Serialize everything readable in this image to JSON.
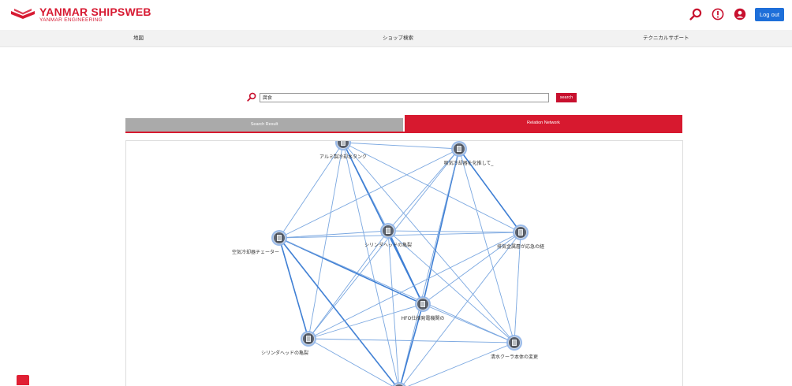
{
  "header": {
    "brand_name": "YANMAR SHIPSWEB",
    "brand_sub": "YANMAR ENGINEERING",
    "logout_label": "Log out",
    "icons": [
      "search-icon",
      "info-icon",
      "user-icon"
    ],
    "accent_color": "#d71a32",
    "logout_color": "#1e6fd9"
  },
  "nav": {
    "items": [
      {
        "label": "地図"
      },
      {
        "label": "ショップ検索"
      },
      {
        "label": "テクニカルサポート"
      }
    ]
  },
  "search": {
    "value": "腐食",
    "button_label": "search"
  },
  "tabs": {
    "search_result": "Search Result",
    "relation_network": "Relation Network",
    "active_color": "#d7192f",
    "inactive_color": "#aaaaaa"
  },
  "network": {
    "nodes": [
      {
        "label": "アルミ製冷却水タンク"
      },
      {
        "label": "吸気冷却器を化推して_"
      },
      {
        "label": "シリンダヘッドの亀裂"
      },
      {
        "label": "空気冷却器チェーター"
      },
      {
        "label": "排気金属層が応急の経"
      },
      {
        "label": "HFO仕様発電機関の"
      },
      {
        "label": "シリンダヘッドの亀裂"
      },
      {
        "label": "清水クーラ本体の変更"
      },
      {
        "label": ""
      }
    ]
  }
}
